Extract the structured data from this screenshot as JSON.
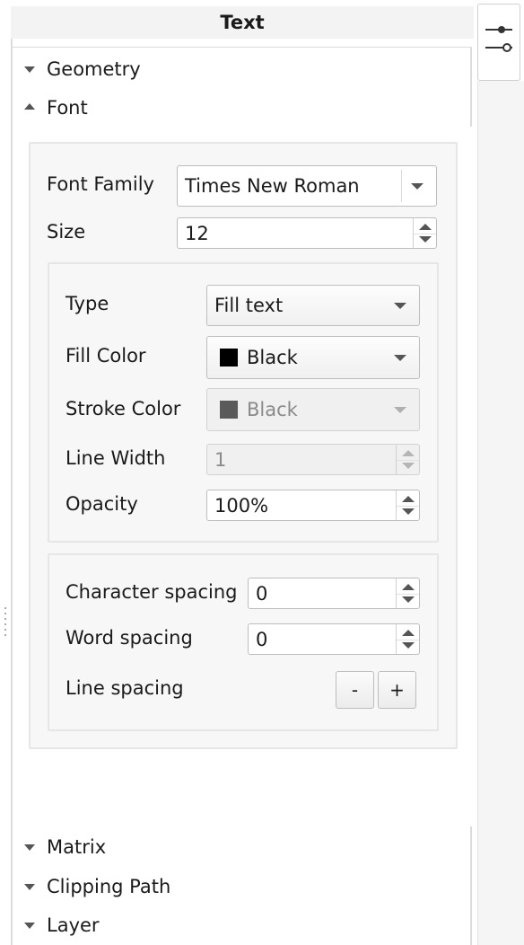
{
  "panel": {
    "title": "Text"
  },
  "sections": {
    "geometry": "Geometry",
    "font": "Font",
    "matrix": "Matrix",
    "clipping_path": "Clipping Path",
    "layer": "Layer"
  },
  "font": {
    "family_label": "Font Family",
    "family_value": "Times New Roman",
    "size_label": "Size",
    "size_value": "12"
  },
  "appearance": {
    "type_label": "Type",
    "type_value": "Fill text",
    "fill_color_label": "Fill Color",
    "fill_color_value": "Black",
    "fill_color_swatch": "#000000",
    "stroke_color_label": "Stroke Color",
    "stroke_color_value": "Black",
    "stroke_color_swatch": "#5a5a5a",
    "line_width_label": "Line Width",
    "line_width_value": "1",
    "opacity_label": "Opacity",
    "opacity_value": "100%"
  },
  "spacing": {
    "character_label": "Character spacing",
    "character_value": "0",
    "word_label": "Word spacing",
    "word_value": "0",
    "line_label": "Line spacing",
    "decrease_label": "-",
    "increase_label": "+"
  },
  "icons": {
    "dock_tab": "sliders-icon",
    "expand": "triangle-down-icon",
    "collapse": "triangle-up-icon"
  }
}
